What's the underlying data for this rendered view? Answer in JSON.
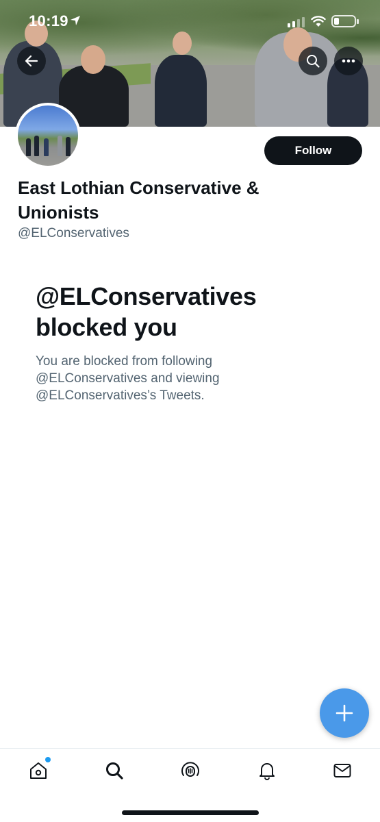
{
  "status_bar": {
    "time": "10:19",
    "battery_level_fraction": 0.25
  },
  "profile": {
    "display_name": "East Lothian Conservative & Unionists",
    "handle": "@ELConservatives",
    "follow_label": "Follow"
  },
  "blocked_notice": {
    "title": "@ELConservatives blocked you",
    "body": "You are blocked from following @ELConservatives and viewing @ELConservatives’s Tweets."
  },
  "icons": {
    "back": "arrow-left-icon",
    "search": "search-icon",
    "more": "more-horizontal-icon",
    "compose": "plus-icon",
    "home": "home-icon",
    "explore": "search-icon",
    "spaces": "spaces-icon",
    "notifications": "bell-icon",
    "messages": "envelope-icon"
  },
  "colors": {
    "accent": "#1d9bf0",
    "fab": "#4a99e9",
    "text_primary": "#0f1419",
    "text_secondary": "#536471",
    "follow_button": "#0f1419"
  }
}
